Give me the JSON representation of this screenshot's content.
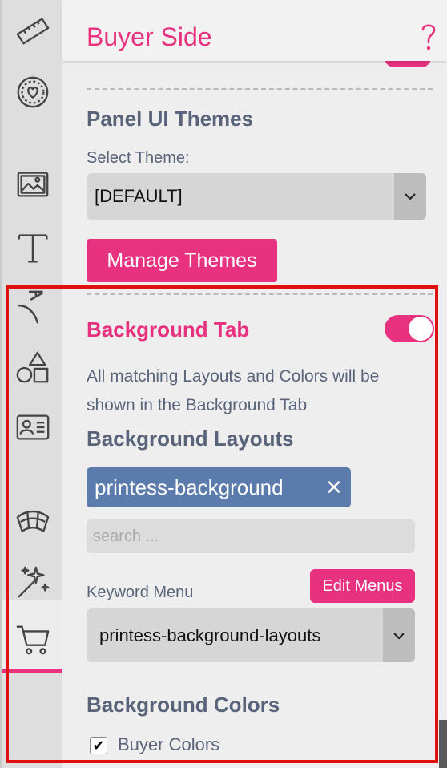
{
  "rail": {
    "items": [
      {
        "name": "ruler-icon"
      },
      {
        "name": "heart-badge-icon"
      },
      {
        "name": "image-icon"
      },
      {
        "name": "text-icon"
      },
      {
        "name": "brush-icon"
      },
      {
        "name": "shapes-icon"
      },
      {
        "name": "id-card-icon"
      },
      {
        "name": "curved-text-icon"
      },
      {
        "name": "magic-wand-icon"
      },
      {
        "name": "cart-icon"
      }
    ],
    "active": "cart-icon",
    "accent": "#e8317f"
  },
  "header": {
    "title": "Buyer Side",
    "help_icon": "question-mark-icon"
  },
  "panel_ui_themes": {
    "heading": "Panel UI Themes",
    "select_label": "Select Theme:",
    "select_value": "[DEFAULT]",
    "manage_button": "Manage Themes"
  },
  "background_tab": {
    "title": "Background Tab",
    "toggle_on": true,
    "description": "All matching Layouts and Colors will be shown in the Background Tab",
    "layouts_heading": "Background Layouts",
    "chip_label": "printess-background",
    "chip_remove": "✕",
    "search_placeholder": "search ...",
    "keyword_label": "Keyword Menu",
    "edit_menus_button": "Edit Menus",
    "keyword_value": "printess-background-layouts",
    "colors_heading": "Background Colors",
    "buyer_colors_label": "Buyer Colors",
    "buyer_colors_checked": true,
    "check_mark": "✔"
  },
  "colors": {
    "accent": "#e8317f",
    "text_slate": "#59647a",
    "chip_blue": "#5c7bad",
    "highlight_frame": "#e01010"
  }
}
